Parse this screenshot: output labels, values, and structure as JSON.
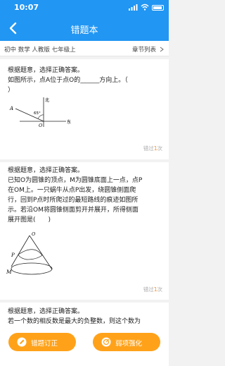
{
  "status": {
    "time": "10:07"
  },
  "nav": {
    "title": "错题本"
  },
  "filter": {
    "label": "初中 数学 人教版 七年级上",
    "chapter": "章节列表"
  },
  "questions": [
    {
      "lines": [
        "根据题意，选择正确答案。",
        "如图所示，点A位于点O的______方向上。（",
        "）"
      ],
      "figure": {
        "north": "北",
        "east": "东",
        "angle": "65°",
        "point_a": "A",
        "point_o": "O"
      },
      "errors_prefix": "错过",
      "errors_count": "1",
      "errors_suffix": "次"
    },
    {
      "lines": [
        "根据题意，选择正确答案。",
        "已知O为圆锥的顶点，M为圆锥底面上一点，点P",
        "在OM上。一只蜗牛从点P出发，绕圆锥侧面爬",
        "行，回到P点时所爬过的最短路线的痕迹如图所",
        "示。若沿OM将圆锥侧面剪开并展开，所得侧面",
        "展开图是(　　)"
      ],
      "figure": {
        "point_o": "O",
        "point_p": "P",
        "point_m": "M"
      },
      "errors_prefix": "错过",
      "errors_count": "1",
      "errors_suffix": "次"
    },
    {
      "lines": [
        "根据题意，选择正确答案。",
        "若一个数的相反数是最大的负整数，则这个数为"
      ]
    }
  ],
  "buttons": {
    "correct": "错题订正",
    "reinforce": "弱项强化"
  },
  "colors": {
    "primary": "#2196f3",
    "accent": "#ffa21a",
    "error_count": "#ff8a1a"
  }
}
